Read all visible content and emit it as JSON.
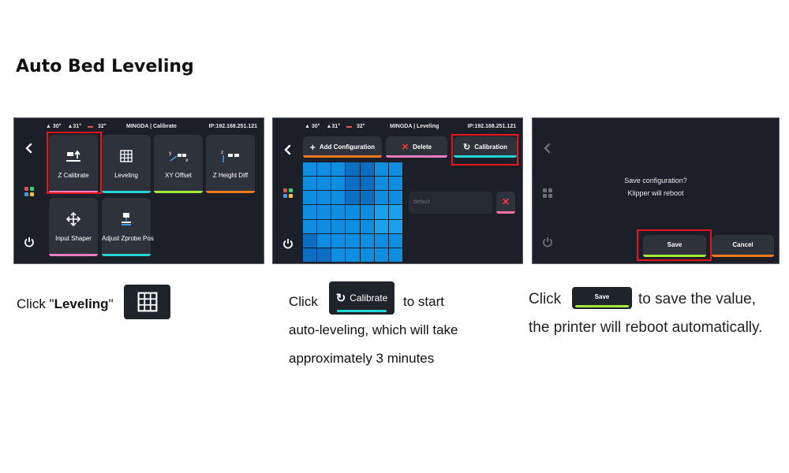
{
  "page_title": "Auto Bed Leveling",
  "status": {
    "temp1": "30°",
    "temp2": "31°",
    "temp3": "32°",
    "title_calibrate": "MINGDA | Calibrate",
    "title_leveling": "MINGDA  | Leveling",
    "ip": "IP:192.168.251.121"
  },
  "screen1": {
    "tiles": [
      {
        "label": "Z Calibrate",
        "bar_color": "#f07cc0"
      },
      {
        "label": "Leveling",
        "bar_color": "#23d6d6"
      },
      {
        "label": "XY Offset",
        "bar_color": "#a4e83a"
      },
      {
        "label": "Z Height Diff",
        "bar_color": "#f07a1a"
      },
      {
        "label": "Input Shaper",
        "bar_color": "#f07cc0"
      },
      {
        "label": "Adjust Zprobe Pos",
        "bar_color": "#23d6d6"
      }
    ]
  },
  "screen2": {
    "add_label": "Add Configuration",
    "delete_label": "Delete",
    "calibration_label": "Calibration",
    "profile_name": "default",
    "add_bar": "#f07a1a",
    "delete_bar": "#f07cc0",
    "calibration_bar": "#23d6d6"
  },
  "screen3": {
    "line1": "Save configuration?",
    "line2": "Klipper will reboot",
    "save_label": "Save",
    "cancel_label": "Cancel",
    "save_bar": "#a4e83a",
    "cancel_bar": "#f07a1a"
  },
  "instructions": {
    "step1_prefix": "Click \"",
    "step1_bold": "Leveling",
    "step1_suffix": "\"",
    "step2_click": "Click",
    "step2_button": "Calibrate",
    "step2_line1_rest": "to start",
    "step2_line2": "auto-leveling, which will take",
    "step2_line3": "approximately 3 minutes",
    "step3_click": "Click",
    "step3_button": "Save",
    "step3_line1_rest": "to save the value,",
    "step3_line2": "the printer will reboot automatically."
  },
  "colors": {
    "screen_bg": "#1c1f27",
    "tile_bg": "#2e323b",
    "highlight": "#e8141c",
    "mesh_blue": "#0d8ee0"
  }
}
